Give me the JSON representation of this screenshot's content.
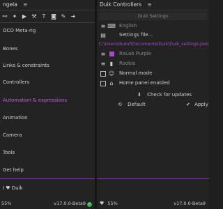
{
  "left_panel": {
    "title": "ngela",
    "menu_icon": "≡",
    "toolbar_icons": [
      "link-icon",
      "bone-icon",
      "play-icon",
      "hammer-icon",
      "text-icon",
      "camera-icon",
      "brush-icon",
      "arrow-icon"
    ],
    "nav_items": [
      "OCO Meta-rig",
      "Bones",
      "Links & constraints",
      "Controllers",
      "Automation & expressions",
      "Animation",
      "Camera",
      "Tools",
      "Get help",
      "I ♥ Duik"
    ],
    "active_index": 4,
    "progress_text": "55%",
    "version": "v17.0.0-Beta9"
  },
  "right_panel": {
    "title": "Duik Controllers",
    "menu_icon": "≡",
    "section_title": "Duik Settings",
    "language": "English",
    "settings_file": "Settings file...",
    "settings_path": "C:\\Users\\duduf\\Documents\\Duik\\Duik_settings.json",
    "color_theme": "RxLab Purple",
    "level": "Rookie",
    "normal_mode": "Normal mode",
    "home_panel": "Home panel enabled",
    "check_updates": "Check for updates",
    "default_button": "Default",
    "apply_button": "Apply",
    "progress_text": "55%",
    "version": "v17.0.0-Beta9",
    "accent_color": "#a64bc7"
  }
}
